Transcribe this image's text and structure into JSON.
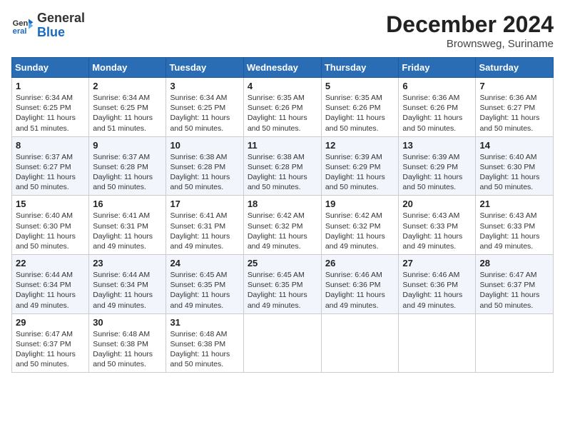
{
  "header": {
    "logo_general": "General",
    "logo_blue": "Blue",
    "month_year": "December 2024",
    "location": "Brownsweg, Suriname"
  },
  "weekdays": [
    "Sunday",
    "Monday",
    "Tuesday",
    "Wednesday",
    "Thursday",
    "Friday",
    "Saturday"
  ],
  "weeks": [
    [
      {
        "day": "1",
        "sunrise": "6:34 AM",
        "sunset": "6:25 PM",
        "daylight": "11 hours and 51 minutes."
      },
      {
        "day": "2",
        "sunrise": "6:34 AM",
        "sunset": "6:25 PM",
        "daylight": "11 hours and 51 minutes."
      },
      {
        "day": "3",
        "sunrise": "6:34 AM",
        "sunset": "6:25 PM",
        "daylight": "11 hours and 50 minutes."
      },
      {
        "day": "4",
        "sunrise": "6:35 AM",
        "sunset": "6:26 PM",
        "daylight": "11 hours and 50 minutes."
      },
      {
        "day": "5",
        "sunrise": "6:35 AM",
        "sunset": "6:26 PM",
        "daylight": "11 hours and 50 minutes."
      },
      {
        "day": "6",
        "sunrise": "6:36 AM",
        "sunset": "6:26 PM",
        "daylight": "11 hours and 50 minutes."
      },
      {
        "day": "7",
        "sunrise": "6:36 AM",
        "sunset": "6:27 PM",
        "daylight": "11 hours and 50 minutes."
      }
    ],
    [
      {
        "day": "8",
        "sunrise": "6:37 AM",
        "sunset": "6:27 PM",
        "daylight": "11 hours and 50 minutes."
      },
      {
        "day": "9",
        "sunrise": "6:37 AM",
        "sunset": "6:28 PM",
        "daylight": "11 hours and 50 minutes."
      },
      {
        "day": "10",
        "sunrise": "6:38 AM",
        "sunset": "6:28 PM",
        "daylight": "11 hours and 50 minutes."
      },
      {
        "day": "11",
        "sunrise": "6:38 AM",
        "sunset": "6:28 PM",
        "daylight": "11 hours and 50 minutes."
      },
      {
        "day": "12",
        "sunrise": "6:39 AM",
        "sunset": "6:29 PM",
        "daylight": "11 hours and 50 minutes."
      },
      {
        "day": "13",
        "sunrise": "6:39 AM",
        "sunset": "6:29 PM",
        "daylight": "11 hours and 50 minutes."
      },
      {
        "day": "14",
        "sunrise": "6:40 AM",
        "sunset": "6:30 PM",
        "daylight": "11 hours and 50 minutes."
      }
    ],
    [
      {
        "day": "15",
        "sunrise": "6:40 AM",
        "sunset": "6:30 PM",
        "daylight": "11 hours and 50 minutes."
      },
      {
        "day": "16",
        "sunrise": "6:41 AM",
        "sunset": "6:31 PM",
        "daylight": "11 hours and 49 minutes."
      },
      {
        "day": "17",
        "sunrise": "6:41 AM",
        "sunset": "6:31 PM",
        "daylight": "11 hours and 49 minutes."
      },
      {
        "day": "18",
        "sunrise": "6:42 AM",
        "sunset": "6:32 PM",
        "daylight": "11 hours and 49 minutes."
      },
      {
        "day": "19",
        "sunrise": "6:42 AM",
        "sunset": "6:32 PM",
        "daylight": "11 hours and 49 minutes."
      },
      {
        "day": "20",
        "sunrise": "6:43 AM",
        "sunset": "6:33 PM",
        "daylight": "11 hours and 49 minutes."
      },
      {
        "day": "21",
        "sunrise": "6:43 AM",
        "sunset": "6:33 PM",
        "daylight": "11 hours and 49 minutes."
      }
    ],
    [
      {
        "day": "22",
        "sunrise": "6:44 AM",
        "sunset": "6:34 PM",
        "daylight": "11 hours and 49 minutes."
      },
      {
        "day": "23",
        "sunrise": "6:44 AM",
        "sunset": "6:34 PM",
        "daylight": "11 hours and 49 minutes."
      },
      {
        "day": "24",
        "sunrise": "6:45 AM",
        "sunset": "6:35 PM",
        "daylight": "11 hours and 49 minutes."
      },
      {
        "day": "25",
        "sunrise": "6:45 AM",
        "sunset": "6:35 PM",
        "daylight": "11 hours and 49 minutes."
      },
      {
        "day": "26",
        "sunrise": "6:46 AM",
        "sunset": "6:36 PM",
        "daylight": "11 hours and 49 minutes."
      },
      {
        "day": "27",
        "sunrise": "6:46 AM",
        "sunset": "6:36 PM",
        "daylight": "11 hours and 49 minutes."
      },
      {
        "day": "28",
        "sunrise": "6:47 AM",
        "sunset": "6:37 PM",
        "daylight": "11 hours and 50 minutes."
      }
    ],
    [
      {
        "day": "29",
        "sunrise": "6:47 AM",
        "sunset": "6:37 PM",
        "daylight": "11 hours and 50 minutes."
      },
      {
        "day": "30",
        "sunrise": "6:48 AM",
        "sunset": "6:38 PM",
        "daylight": "11 hours and 50 minutes."
      },
      {
        "day": "31",
        "sunrise": "6:48 AM",
        "sunset": "6:38 PM",
        "daylight": "11 hours and 50 minutes."
      },
      null,
      null,
      null,
      null
    ]
  ]
}
